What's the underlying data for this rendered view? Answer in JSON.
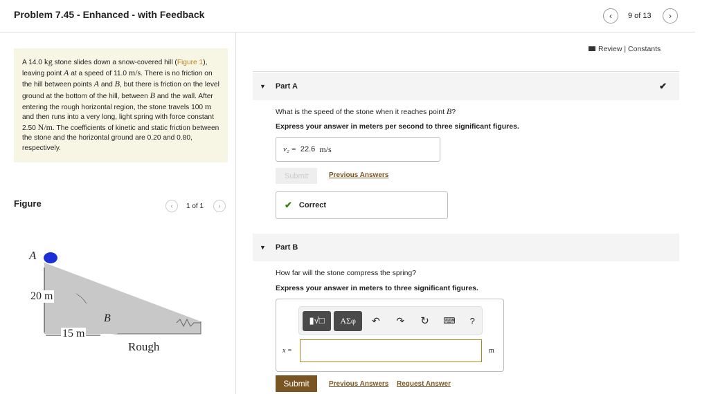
{
  "header": {
    "title": "Problem 7.45 - Enhanced - with Feedback",
    "page_indicator": "9 of 13"
  },
  "links": {
    "review": "Review",
    "separator": "|",
    "constants": "Constants"
  },
  "problem": {
    "p1": "A 14.0 ",
    "kg": "kg",
    " p2": "",
    "p2": " stone slides down a snow-covered hill (",
    "figure_link": "Figure 1",
    "p3": "), leaving point ",
    "A": "A",
    "p4": " at a speed of 11.0 ",
    "ms": "m/s",
    "p5": ". There is no friction on the hill between points ",
    "and": " and ",
    "B": "B",
    "p6": ", but there is friction on the level ground at the bottom of the hill, between ",
    "p7": " and the wall. After entering the rough horizontal region, the stone travels 100 ",
    "m": "m",
    "p8": " and then runs into a very long, light spring with force constant 2.50 ",
    "Nm": "N/m",
    "p9": ". The coefficients of kinetic and static friction between the stone and the horizontal ground are 0.20 and 0.80, respectively."
  },
  "figure": {
    "label": "Figure",
    "pager": "1 of 1",
    "point_a": "A",
    "point_b": "B",
    "height": "20 m",
    "width": "15 m",
    "rough": "Rough"
  },
  "partA": {
    "title": "Part A",
    "question_pre": "What is the speed of the stone when it reaches point ",
    "question_var": "B",
    "question_post": "?",
    "instruction": "Express your answer in meters per second to three significant figures.",
    "answer_label": "v₂ =",
    "answer_value": "22.6",
    "answer_unit": "m/s",
    "submit": "Submit",
    "previous": "Previous Answers",
    "feedback": "Correct",
    "status_color": "#3a7d1e"
  },
  "partB": {
    "title": "Part B",
    "question": "How far will the stone compress the spring?",
    "instruction": "Express your answer in meters to three significant figures.",
    "toolbar": {
      "templates": "▮√□",
      "symbols": "AΣφ",
      "help": "?"
    },
    "answer_label": "x =",
    "answer_value": "",
    "unit": "m",
    "submit": "Submit",
    "previous": "Previous Answers",
    "request": "Request Answer"
  },
  "colors": {
    "accent": "#7a5524",
    "problem_bg": "#f7f6e4"
  }
}
